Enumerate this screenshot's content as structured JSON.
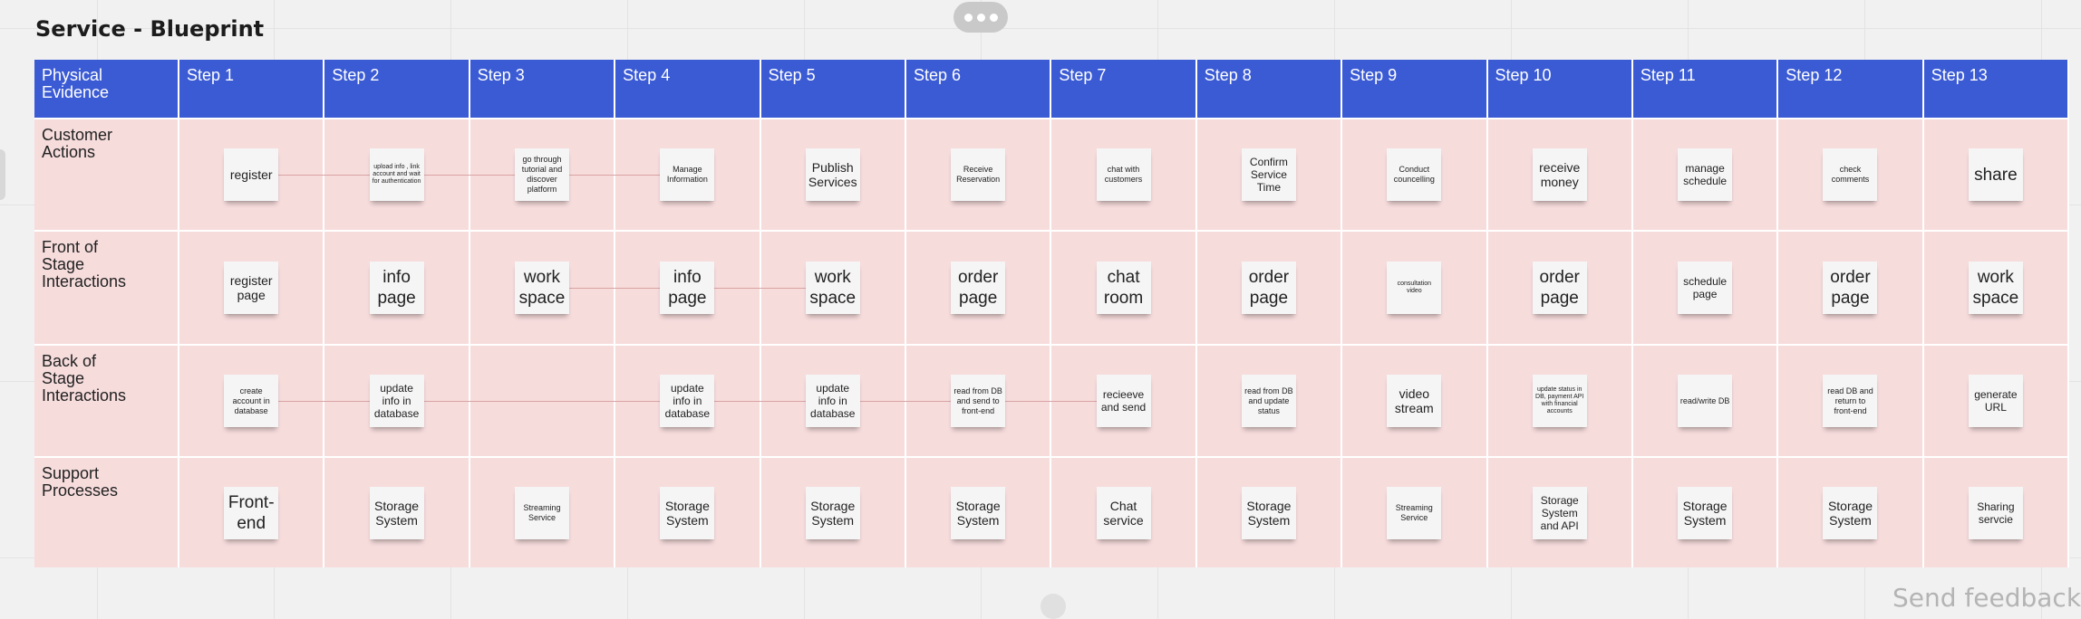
{
  "board": {
    "title": "Service - Blueprint",
    "header": {
      "corner": [
        "Physical",
        "Evidence"
      ],
      "steps": [
        "Step 1",
        "Step 2",
        "Step 3",
        "Step 4",
        "Step 5",
        "Step 6",
        "Step 7",
        "Step 8",
        "Step 9",
        "Step 10",
        "Step 11",
        "Step 12",
        "Step 13"
      ]
    },
    "rows": [
      {
        "label": [
          "Customer",
          "Actions"
        ],
        "cells": [
          {
            "text": "register",
            "size": "l"
          },
          {
            "text": "upload info , link account and wait for authentication",
            "size": "xs"
          },
          {
            "text": "go through tutorial and discover platform",
            "size": "s"
          },
          {
            "text": "Manage Information",
            "size": "s"
          },
          {
            "text": "Publish Services",
            "size": "l"
          },
          {
            "text": "Receive Reservation",
            "size": "s"
          },
          {
            "text": "chat with customers",
            "size": "s"
          },
          {
            "text": "Confirm Service Time",
            "size": "m"
          },
          {
            "text": "Conduct councelling",
            "size": "s"
          },
          {
            "text": "receive money",
            "size": "l"
          },
          {
            "text": "manage schedule",
            "size": "m"
          },
          {
            "text": "check comments",
            "size": "s"
          },
          {
            "text": "share",
            "size": "xl"
          }
        ]
      },
      {
        "label": [
          "Front of",
          "Stage Interactions"
        ],
        "cells": [
          {
            "text": "register page",
            "size": "l"
          },
          {
            "text": "info page",
            "size": "xl"
          },
          {
            "text": "work space",
            "size": "xl"
          },
          {
            "text": "info page",
            "size": "xl"
          },
          {
            "text": "work space",
            "size": "xl"
          },
          {
            "text": "order page",
            "size": "xl"
          },
          {
            "text": "chat room",
            "size": "xl"
          },
          {
            "text": "order page",
            "size": "xl"
          },
          {
            "text": "consultation video",
            "size": "xs"
          },
          {
            "text": "order page",
            "size": "xl"
          },
          {
            "text": "schedule page",
            "size": "m"
          },
          {
            "text": "order page",
            "size": "xl"
          },
          {
            "text": "work space",
            "size": "xl"
          }
        ]
      },
      {
        "label": [
          "Back of",
          "Stage Interactions"
        ],
        "cells": [
          {
            "text": "create account in database",
            "size": "s"
          },
          {
            "text": "update info in database",
            "size": "m"
          },
          {
            "text": "",
            "size": "s"
          },
          {
            "text": "update info in database",
            "size": "m"
          },
          {
            "text": "update info in database",
            "size": "m"
          },
          {
            "text": "read from DB and send to front-end",
            "size": "s"
          },
          {
            "text": "recieeve and send",
            "size": "m"
          },
          {
            "text": "read from DB and update status",
            "size": "s"
          },
          {
            "text": "video stream",
            "size": "l"
          },
          {
            "text": "update status in DB, payment API with financial accounts",
            "size": "xs"
          },
          {
            "text": "read/write DB",
            "size": "s"
          },
          {
            "text": "read DB and return to front-end",
            "size": "s"
          },
          {
            "text": "generate URL",
            "size": "m"
          }
        ]
      },
      {
        "label": [
          "Support",
          "Processes"
        ],
        "cells": [
          {
            "text": "Front-end",
            "size": "xl"
          },
          {
            "text": "Storage System",
            "size": "l"
          },
          {
            "text": "Streaming Service",
            "size": "s"
          },
          {
            "text": "Storage System",
            "size": "l"
          },
          {
            "text": "Storage System",
            "size": "l"
          },
          {
            "text": "Storage System",
            "size": "l"
          },
          {
            "text": "Chat service",
            "size": "l"
          },
          {
            "text": "Storage System",
            "size": "l"
          },
          {
            "text": "Streaming Service",
            "size": "s"
          },
          {
            "text": "Storage System and API",
            "size": "m"
          },
          {
            "text": "Storage System",
            "size": "l"
          },
          {
            "text": "Storage System",
            "size": "l"
          },
          {
            "text": "Sharing servcie",
            "size": "m"
          }
        ]
      }
    ]
  },
  "footer": {
    "feedback_label": "Send feedback"
  }
}
